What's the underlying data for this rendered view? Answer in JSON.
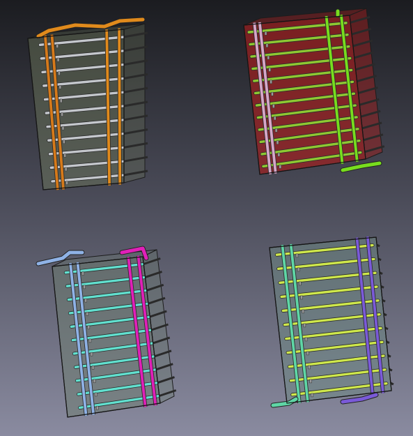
{
  "viewport": {
    "background_top": "#1b1c20",
    "background_bottom": "#8a8ba0"
  },
  "models": [
    {
      "name": "model-top-left",
      "panel_fill": "#6f7a5c",
      "panel_opacity": 0.45,
      "rung_color": "#c4c7cc",
      "left_rail_color": "#d67a1a",
      "right_rail_color": "#e08a1c",
      "rung_count": 11
    },
    {
      "name": "model-top-right",
      "panel_fill": "#a11f1f",
      "panel_opacity": 0.7,
      "rung_color": "#8fc832",
      "left_rail_color": "#d6a6c8",
      "right_rail_color": "#78dd1e",
      "rung_count": 12
    },
    {
      "name": "model-bottom-left",
      "panel_fill": "#6e7d70",
      "panel_opacity": 0.5,
      "rung_color": "#62e0cf",
      "left_rail_color": "#8fb2e6",
      "right_rail_color": "#e020b8",
      "rung_count": 11
    },
    {
      "name": "model-bottom-right",
      "panel_fill": "#6e8a84",
      "panel_opacity": 0.5,
      "rung_color": "#cfe84c",
      "left_rail_color": "#5fd6a6",
      "right_rail_color": "#7a5ad8",
      "rung_count": 11
    }
  ]
}
